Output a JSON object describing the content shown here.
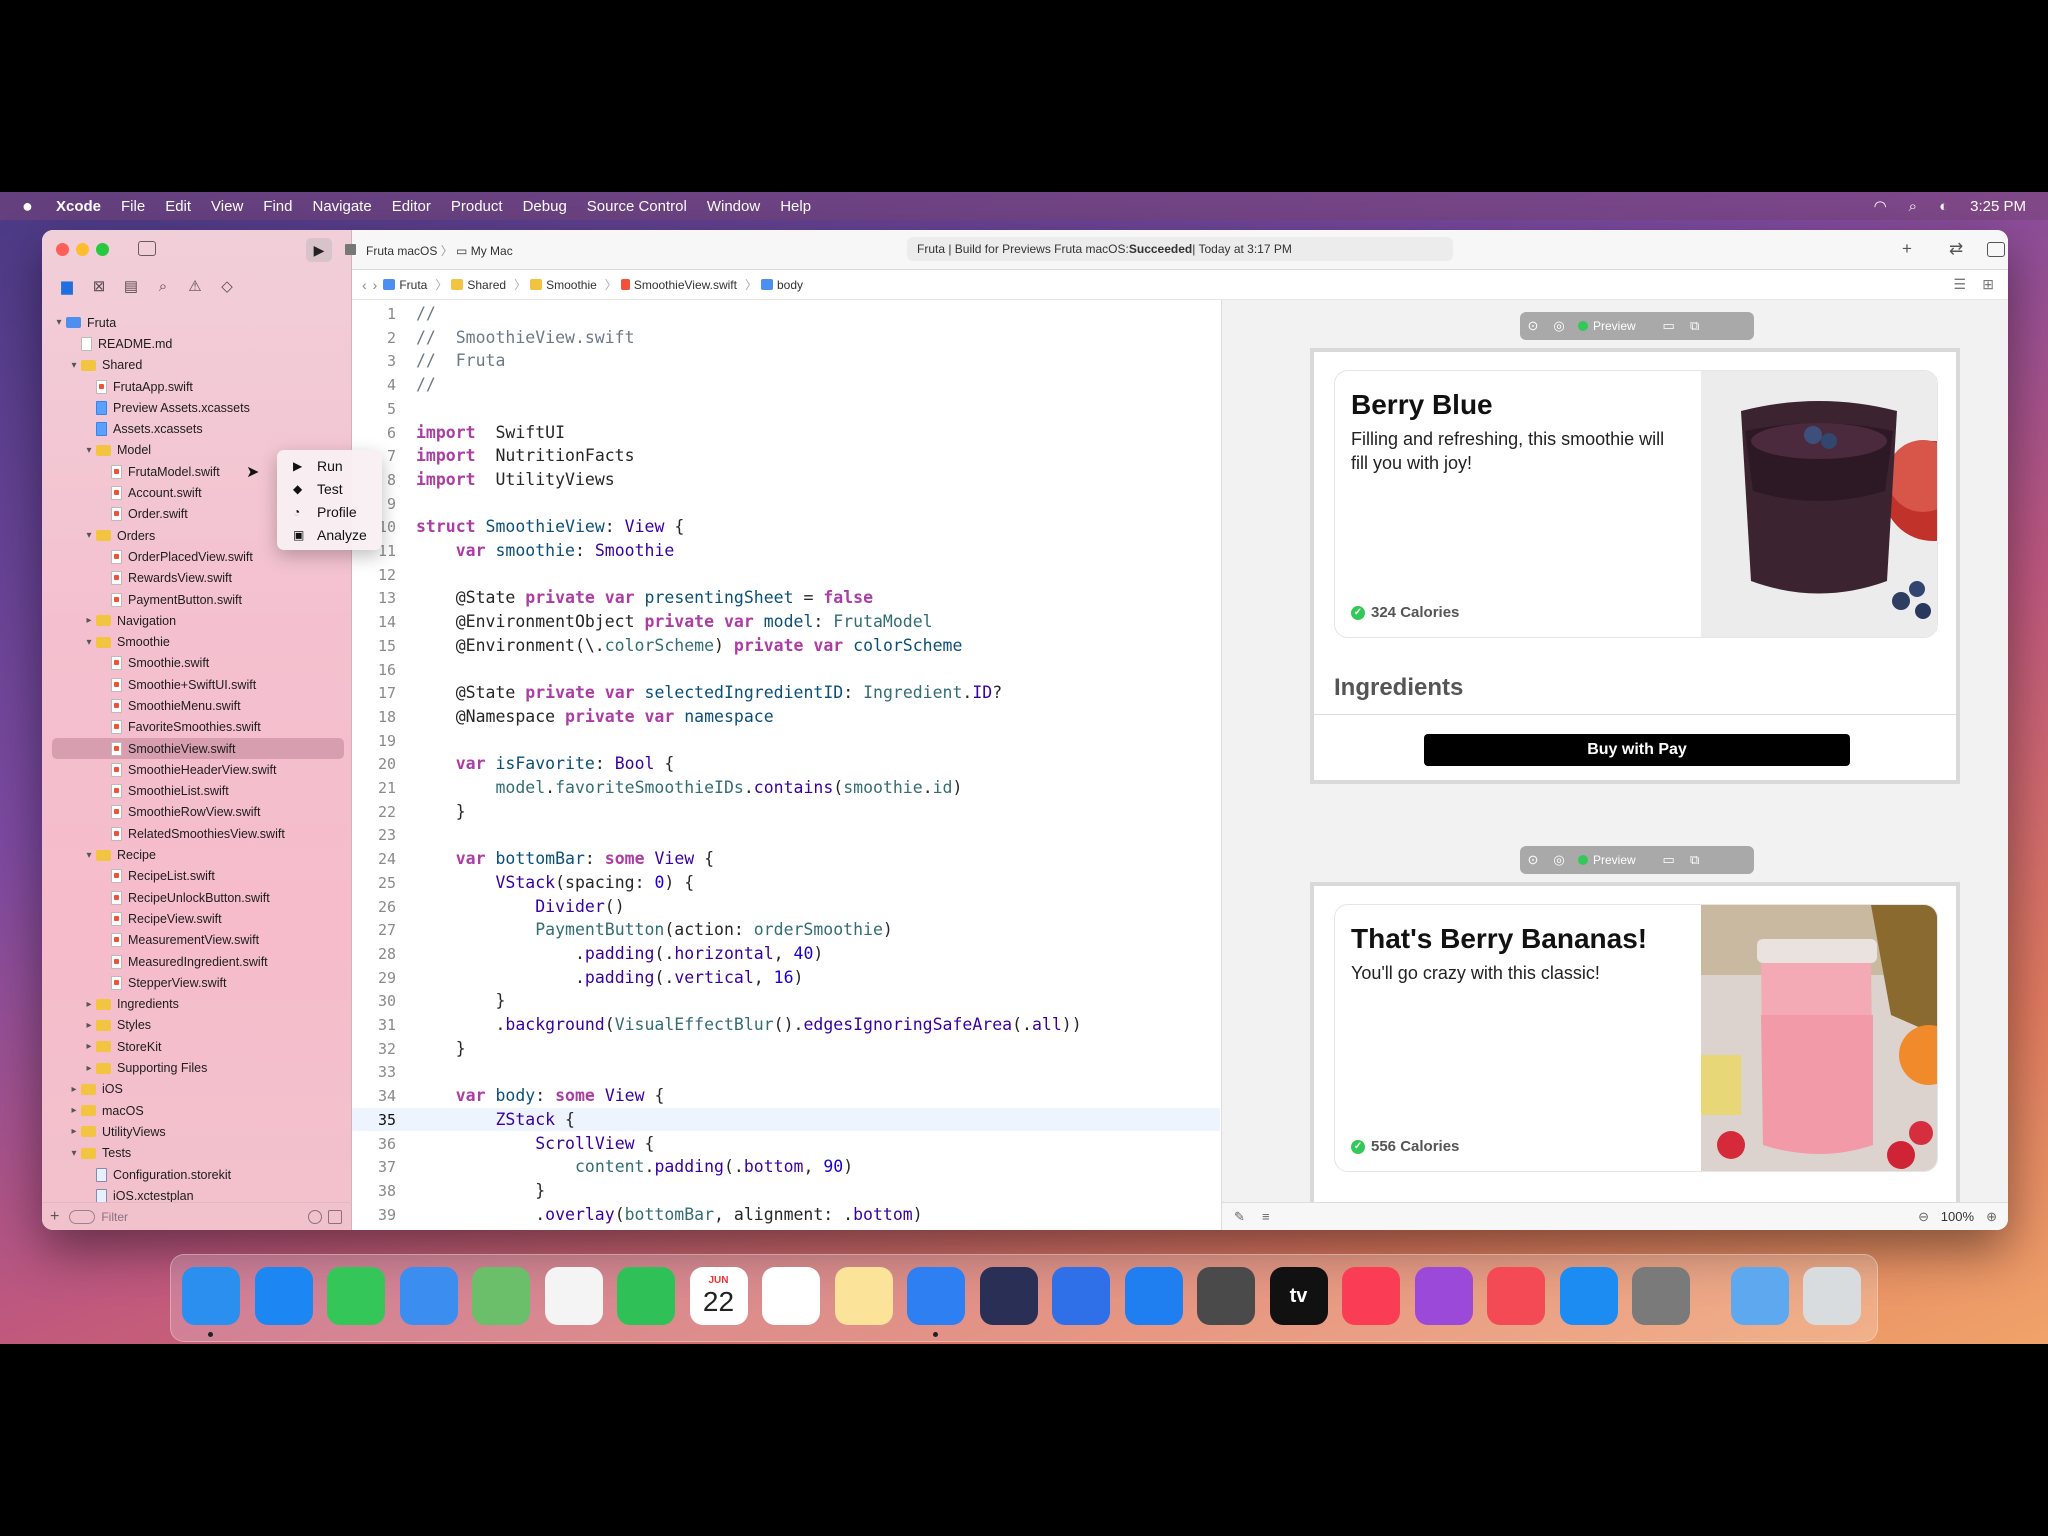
{
  "menubar": {
    "apple": "",
    "items": [
      "Xcode",
      "File",
      "Edit",
      "View",
      "Find",
      "Navigate",
      "Editor",
      "Product",
      "Debug",
      "Source Control",
      "Window",
      "Help"
    ],
    "clock": "3:25 PM"
  },
  "toolbar": {
    "scheme": "Fruta macOS",
    "destination": "My Mac",
    "activity_prefix": "Fruta | Build for Previews Fruta macOS: ",
    "activity_status": "Succeeded",
    "activity_suffix": " | Today at 3:17 PM"
  },
  "run_menu": {
    "items": [
      "Run",
      "Test",
      "Profile",
      "Analyze"
    ]
  },
  "jumpbar": {
    "crumbs": [
      "Fruta",
      "Shared",
      "Smoothie",
      "SmoothieView.swift",
      "body"
    ]
  },
  "navigator": {
    "filter_placeholder": "Filter",
    "rows": [
      {
        "label": "Fruta",
        "depth": 0,
        "kind": "project",
        "chev": "v"
      },
      {
        "label": "README.md",
        "depth": 1,
        "kind": "file"
      },
      {
        "label": "Shared",
        "depth": 1,
        "kind": "folder",
        "chev": "v"
      },
      {
        "label": "FrutaApp.swift",
        "depth": 2,
        "kind": "swift"
      },
      {
        "label": "Preview Assets.xcassets",
        "depth": 2,
        "kind": "assets"
      },
      {
        "label": "Assets.xcassets",
        "depth": 2,
        "kind": "assets"
      },
      {
        "label": "Model",
        "depth": 2,
        "kind": "folder",
        "chev": "v"
      },
      {
        "label": "FrutaModel.swift",
        "depth": 3,
        "kind": "swift"
      },
      {
        "label": "Account.swift",
        "depth": 3,
        "kind": "swift"
      },
      {
        "label": "Order.swift",
        "depth": 3,
        "kind": "swift"
      },
      {
        "label": "Orders",
        "depth": 2,
        "kind": "folder",
        "chev": "v"
      },
      {
        "label": "OrderPlacedView.swift",
        "depth": 3,
        "kind": "swift"
      },
      {
        "label": "RewardsView.swift",
        "depth": 3,
        "kind": "swift"
      },
      {
        "label": "PaymentButton.swift",
        "depth": 3,
        "kind": "swift"
      },
      {
        "label": "Navigation",
        "depth": 2,
        "kind": "folder",
        "chev": ">"
      },
      {
        "label": "Smoothie",
        "depth": 2,
        "kind": "folder",
        "chev": "v"
      },
      {
        "label": "Smoothie.swift",
        "depth": 3,
        "kind": "swift"
      },
      {
        "label": "Smoothie+SwiftUI.swift",
        "depth": 3,
        "kind": "swift"
      },
      {
        "label": "SmoothieMenu.swift",
        "depth": 3,
        "kind": "swift"
      },
      {
        "label": "FavoriteSmoothies.swift",
        "depth": 3,
        "kind": "swift"
      },
      {
        "label": "SmoothieView.swift",
        "depth": 3,
        "kind": "swift",
        "selected": true
      },
      {
        "label": "SmoothieHeaderView.swift",
        "depth": 3,
        "kind": "swift"
      },
      {
        "label": "SmoothieList.swift",
        "depth": 3,
        "kind": "swift"
      },
      {
        "label": "SmoothieRowView.swift",
        "depth": 3,
        "kind": "swift"
      },
      {
        "label": "RelatedSmoothiesView.swift",
        "depth": 3,
        "kind": "swift"
      },
      {
        "label": "Recipe",
        "depth": 2,
        "kind": "folder",
        "chev": "v"
      },
      {
        "label": "RecipeList.swift",
        "depth": 3,
        "kind": "swift"
      },
      {
        "label": "RecipeUnlockButton.swift",
        "depth": 3,
        "kind": "swift"
      },
      {
        "label": "RecipeView.swift",
        "depth": 3,
        "kind": "swift"
      },
      {
        "label": "MeasurementView.swift",
        "depth": 3,
        "kind": "swift"
      },
      {
        "label": "MeasuredIngredient.swift",
        "depth": 3,
        "kind": "swift"
      },
      {
        "label": "StepperView.swift",
        "depth": 3,
        "kind": "swift"
      },
      {
        "label": "Ingredients",
        "depth": 2,
        "kind": "folder",
        "chev": ">"
      },
      {
        "label": "Styles",
        "depth": 2,
        "kind": "folder",
        "chev": ">"
      },
      {
        "label": "StoreKit",
        "depth": 2,
        "kind": "folder",
        "chev": ">"
      },
      {
        "label": "Supporting Files",
        "depth": 2,
        "kind": "folder",
        "chev": ">"
      },
      {
        "label": "iOS",
        "depth": 1,
        "kind": "folder",
        "chev": ">"
      },
      {
        "label": "macOS",
        "depth": 1,
        "kind": "folder",
        "chev": ">"
      },
      {
        "label": "UtilityViews",
        "depth": 1,
        "kind": "folder",
        "chev": ">"
      },
      {
        "label": "Tests",
        "depth": 1,
        "kind": "folder",
        "chev": "v"
      },
      {
        "label": "Configuration.storekit",
        "depth": 2,
        "kind": "store"
      },
      {
        "label": "iOS.xctestplan",
        "depth": 2,
        "kind": "store"
      }
    ]
  },
  "editor": {
    "current_line": 35,
    "lines": [
      {
        "n": 1,
        "t": [
          [
            "cm",
            "//"
          ]
        ]
      },
      {
        "n": 2,
        "t": [
          [
            "cm",
            "//  SmoothieView.swift"
          ]
        ]
      },
      {
        "n": 3,
        "t": [
          [
            "cm",
            "//  Fruta"
          ]
        ]
      },
      {
        "n": 4,
        "t": [
          [
            "cm",
            "//"
          ]
        ]
      },
      {
        "n": 5,
        "t": []
      },
      {
        "n": 6,
        "t": [
          [
            "kw",
            "import"
          ],
          [
            "",
            "  SwiftUI"
          ]
        ]
      },
      {
        "n": 7,
        "t": [
          [
            "kw",
            "import"
          ],
          [
            "",
            "  NutritionFacts"
          ]
        ]
      },
      {
        "n": 8,
        "t": [
          [
            "kw",
            "import"
          ],
          [
            "",
            "  UtilityViews"
          ]
        ]
      },
      {
        "n": 9,
        "t": []
      },
      {
        "n": 10,
        "t": [
          [
            "kw",
            "struct"
          ],
          [
            "",
            " "
          ],
          [
            "ty",
            "SmoothieView"
          ],
          [
            "",
            ": "
          ],
          [
            "ty2",
            "View"
          ],
          [
            "",
            " {"
          ]
        ]
      },
      {
        "n": 11,
        "t": [
          [
            "",
            "    "
          ],
          [
            "kw",
            "var"
          ],
          [
            "",
            " "
          ],
          [
            "ty",
            "smoothie"
          ],
          [
            "",
            ": "
          ],
          [
            "ty2",
            "Smoothie"
          ]
        ]
      },
      {
        "n": 12,
        "t": []
      },
      {
        "n": 13,
        "t": [
          [
            "",
            "    @State "
          ],
          [
            "kw",
            "private"
          ],
          [
            "",
            " "
          ],
          [
            "kw",
            "var"
          ],
          [
            "",
            " "
          ],
          [
            "ty",
            "presentingSheet"
          ],
          [
            "",
            " = "
          ],
          [
            "kw",
            "false"
          ]
        ]
      },
      {
        "n": 14,
        "t": [
          [
            "",
            "    @EnvironmentObject "
          ],
          [
            "kw",
            "private"
          ],
          [
            "",
            " "
          ],
          [
            "kw",
            "var"
          ],
          [
            "",
            " "
          ],
          [
            "ty",
            "model"
          ],
          [
            "",
            ": "
          ],
          [
            "pr",
            "FrutaModel"
          ]
        ]
      },
      {
        "n": 15,
        "t": [
          [
            "",
            "    @Environment(\\."
          ],
          [
            "pr",
            "colorScheme"
          ],
          [
            "",
            ") "
          ],
          [
            "kw",
            "private"
          ],
          [
            "",
            " "
          ],
          [
            "kw",
            "var"
          ],
          [
            "",
            " "
          ],
          [
            "ty",
            "colorScheme"
          ]
        ]
      },
      {
        "n": 16,
        "t": []
      },
      {
        "n": 17,
        "t": [
          [
            "",
            "    @State "
          ],
          [
            "kw",
            "private"
          ],
          [
            "",
            " "
          ],
          [
            "kw",
            "var"
          ],
          [
            "",
            " "
          ],
          [
            "ty",
            "selectedIngredientID"
          ],
          [
            "",
            ": "
          ],
          [
            "pr",
            "Ingredient"
          ],
          [
            "",
            "."
          ],
          [
            "ty2",
            "ID"
          ],
          [
            "",
            "?"
          ]
        ]
      },
      {
        "n": 18,
        "t": [
          [
            "",
            "    @Namespace "
          ],
          [
            "kw",
            "private"
          ],
          [
            "",
            " "
          ],
          [
            "kw",
            "var"
          ],
          [
            "",
            " "
          ],
          [
            "ty",
            "namespace"
          ]
        ]
      },
      {
        "n": 19,
        "t": []
      },
      {
        "n": 20,
        "t": [
          [
            "",
            "    "
          ],
          [
            "kw",
            "var"
          ],
          [
            "",
            " "
          ],
          [
            "ty",
            "isFavorite"
          ],
          [
            "",
            ": "
          ],
          [
            "ty2",
            "Bool"
          ],
          [
            "",
            " {"
          ]
        ]
      },
      {
        "n": 21,
        "t": [
          [
            "",
            "        "
          ],
          [
            "pr",
            "model"
          ],
          [
            "",
            "."
          ],
          [
            "pr",
            "favoriteSmoothieIDs"
          ],
          [
            "",
            "."
          ],
          [
            "ty2",
            "contains"
          ],
          [
            "",
            "("
          ],
          [
            "pr",
            "smoothie"
          ],
          [
            "",
            "."
          ],
          [
            "pr",
            "id"
          ],
          [
            "",
            ")"
          ]
        ]
      },
      {
        "n": 22,
        "t": [
          [
            "",
            "    }"
          ]
        ]
      },
      {
        "n": 23,
        "t": []
      },
      {
        "n": 24,
        "t": [
          [
            "",
            "    "
          ],
          [
            "kw",
            "var"
          ],
          [
            "",
            " "
          ],
          [
            "ty",
            "bottomBar"
          ],
          [
            "",
            ": "
          ],
          [
            "kw",
            "some"
          ],
          [
            "",
            " "
          ],
          [
            "ty2",
            "View"
          ],
          [
            "",
            " {"
          ]
        ]
      },
      {
        "n": 25,
        "t": [
          [
            "",
            "        "
          ],
          [
            "ty2",
            "VStack"
          ],
          [
            "",
            "(spacing: "
          ],
          [
            "nm",
            "0"
          ],
          [
            "",
            ") {"
          ]
        ]
      },
      {
        "n": 26,
        "t": [
          [
            "",
            "            "
          ],
          [
            "ty2",
            "Divider"
          ],
          [
            "",
            "()"
          ]
        ]
      },
      {
        "n": 27,
        "t": [
          [
            "",
            "            "
          ],
          [
            "pr",
            "PaymentButton"
          ],
          [
            "",
            "(action: "
          ],
          [
            "pr",
            "orderSmoothie"
          ],
          [
            "",
            ")"
          ]
        ]
      },
      {
        "n": 28,
        "t": [
          [
            "",
            "                ."
          ],
          [
            "ty2",
            "padding"
          ],
          [
            "",
            "(."
          ],
          [
            "ty2",
            "horizontal"
          ],
          [
            "",
            ", "
          ],
          [
            "nm",
            "40"
          ],
          [
            "",
            ")"
          ]
        ]
      },
      {
        "n": 29,
        "t": [
          [
            "",
            "                ."
          ],
          [
            "ty2",
            "padding"
          ],
          [
            "",
            "(."
          ],
          [
            "ty2",
            "vertical"
          ],
          [
            "",
            ", "
          ],
          [
            "nm",
            "16"
          ],
          [
            "",
            ")"
          ]
        ]
      },
      {
        "n": 30,
        "t": [
          [
            "",
            "        }"
          ]
        ]
      },
      {
        "n": 31,
        "t": [
          [
            "",
            "        ."
          ],
          [
            "ty2",
            "background"
          ],
          [
            "",
            "("
          ],
          [
            "pr",
            "VisualEffectBlur"
          ],
          [
            "",
            "()."
          ],
          [
            "ty2",
            "edgesIgnoringSafeArea"
          ],
          [
            "",
            "(."
          ],
          [
            "ty2",
            "all"
          ],
          [
            "",
            "))"
          ]
        ]
      },
      {
        "n": 32,
        "t": [
          [
            "",
            "    }"
          ]
        ]
      },
      {
        "n": 33,
        "t": []
      },
      {
        "n": 34,
        "t": [
          [
            "",
            "    "
          ],
          [
            "kw",
            "var"
          ],
          [
            "",
            " "
          ],
          [
            "ty",
            "body"
          ],
          [
            "",
            ": "
          ],
          [
            "kw",
            "some"
          ],
          [
            "",
            " "
          ],
          [
            "ty2",
            "View"
          ],
          [
            "",
            " {"
          ]
        ]
      },
      {
        "n": 35,
        "t": [
          [
            "",
            "        "
          ],
          [
            "ty2",
            "ZStack"
          ],
          [
            "",
            " {"
          ]
        ]
      },
      {
        "n": 36,
        "t": [
          [
            "",
            "            "
          ],
          [
            "ty2",
            "ScrollView"
          ],
          [
            "",
            " {"
          ]
        ]
      },
      {
        "n": 37,
        "t": [
          [
            "",
            "                "
          ],
          [
            "pr",
            "content"
          ],
          [
            "",
            "."
          ],
          [
            "ty2",
            "padding"
          ],
          [
            "",
            "(."
          ],
          [
            "ty2",
            "bottom"
          ],
          [
            "",
            ", "
          ],
          [
            "nm",
            "90"
          ],
          [
            "",
            ")"
          ]
        ]
      },
      {
        "n": 38,
        "t": [
          [
            "",
            "            }"
          ]
        ]
      },
      {
        "n": 39,
        "t": [
          [
            "",
            "            ."
          ],
          [
            "ty2",
            "overlay"
          ],
          [
            "",
            "("
          ],
          [
            "pr",
            "bottomBar"
          ],
          [
            "",
            ", alignment: ."
          ],
          [
            "ty2",
            "bottom"
          ],
          [
            "",
            ")"
          ]
        ]
      },
      {
        "n": 40,
        "t": []
      }
    ]
  },
  "canvas": {
    "preview_label": "Preview",
    "zoom": "100%",
    "previews": [
      {
        "title": "Berry Blue",
        "desc": "Filling and refreshing, this smoothie will fill you with joy!",
        "calories": "324 Calories",
        "ingredients": "Ingredients",
        "pay": "Buy with  Pay"
      },
      {
        "title": "That's Berry Bananas!",
        "desc": "You'll go crazy with this classic!",
        "calories": "556 Calories"
      }
    ]
  },
  "dock": {
    "calendar_month": "JUN",
    "calendar_day": "22",
    "tv_label": "tv",
    "apps": [
      {
        "name": "finder",
        "color": "#2b8ff0"
      },
      {
        "name": "safari",
        "color": "#1c86f2"
      },
      {
        "name": "messages",
        "color": "#35c659"
      },
      {
        "name": "mail",
        "color": "#3c8df0"
      },
      {
        "name": "maps",
        "color": "#6bbf6a"
      },
      {
        "name": "photos",
        "color": "#f4f4f4"
      },
      {
        "name": "facetime",
        "color": "#2fc158"
      },
      {
        "name": "calendar",
        "color": "#ffffff"
      },
      {
        "name": "reminders",
        "color": "#ffffff"
      },
      {
        "name": "notes",
        "color": "#fbe39a"
      },
      {
        "name": "xcode",
        "color": "#2d7ff2"
      },
      {
        "name": "instruments",
        "color": "#2a2f55"
      },
      {
        "name": "simulator",
        "color": "#2f6fe8"
      },
      {
        "name": "accessibility-inspector",
        "color": "#1f7ff0"
      },
      {
        "name": "reality-composer",
        "color": "#4a4a4a"
      },
      {
        "name": "apple-tv",
        "color": "#111111"
      },
      {
        "name": "music",
        "color": "#fa3c54"
      },
      {
        "name": "podcasts",
        "color": "#9b49d8"
      },
      {
        "name": "news",
        "color": "#f34a55"
      },
      {
        "name": "app-store",
        "color": "#1c8cf3"
      },
      {
        "name": "system-preferences",
        "color": "#7a7a7a"
      },
      {
        "name": "downloads",
        "color": "#5ea8f0"
      },
      {
        "name": "trash",
        "color": "#d8dcdf"
      }
    ]
  }
}
